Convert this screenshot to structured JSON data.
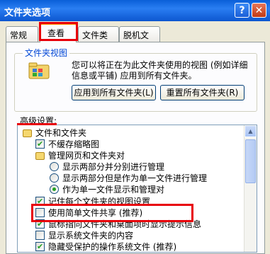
{
  "window": {
    "title": "文件夹选项",
    "help_label": "?",
    "close_label": "✕"
  },
  "tabs": [
    "常规",
    "查看",
    "文件类型",
    "脱机文件"
  ],
  "folder_views": {
    "legend": "文件夹视图",
    "description": "您可以将正在为此文件夹使用的视图 (例如详细信息或平铺) 应用到所有文件夹。",
    "apply_all_button": "应用到所有文件夹(L)",
    "reset_all_button": "重置所有文件夹(R)"
  },
  "advanced": {
    "label": "高级设置:",
    "items": [
      {
        "type": "folder",
        "label": "文件和文件夹"
      },
      {
        "type": "checkbox",
        "checked": true,
        "label": "不缓存缩略图"
      },
      {
        "type": "folder",
        "label": "管理网页和文件夹对"
      },
      {
        "type": "radio",
        "checked": false,
        "label": "显示两部分并分别进行管理"
      },
      {
        "type": "radio",
        "checked": false,
        "label": "显示两部分但是作为单一文件进行管理"
      },
      {
        "type": "radio",
        "checked": true,
        "label": "作为单一文件显示和管理对"
      },
      {
        "type": "checkbox",
        "checked": true,
        "label": "记住每个文件夹的视图设置"
      },
      {
        "type": "checkbox",
        "checked": false,
        "label": "使用简单文件共享 (推荐)"
      },
      {
        "type": "checkbox",
        "checked": true,
        "label": "鼠标指向文件夹和桌面项时显示提示信息"
      },
      {
        "type": "checkbox",
        "checked": false,
        "label": "显示系统文件夹的内容"
      },
      {
        "type": "checkbox",
        "checked": true,
        "label": "隐藏受保护的操作系统文件 (推荐)"
      }
    ]
  }
}
